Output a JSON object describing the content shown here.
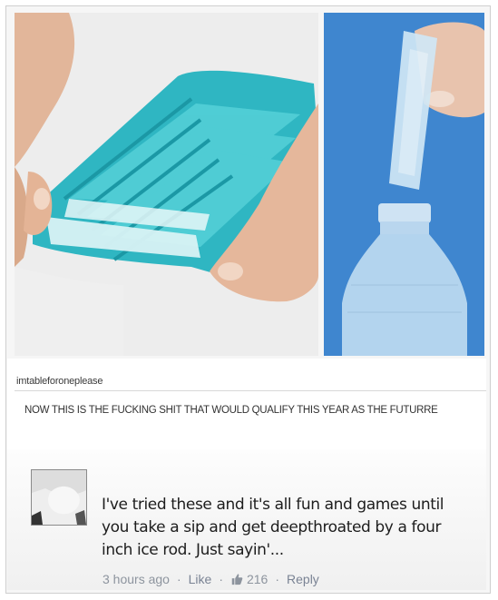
{
  "post": {
    "username": "imtableforoneplease",
    "text": "NOW THIS IS THE FUCKING SHIT THAT WOULD QUALIFY THIS YEAR AS THE FUTURRE"
  },
  "comment": {
    "text": "I've tried these and it's all fun and games until you take a sip and get deepthroated by a four inch ice rod. Just sayin'...",
    "time": "3 hours ago",
    "like_label": "Like",
    "like_count": "216",
    "reply_label": "Reply",
    "separator": "·"
  },
  "colors": {
    "tray": "#2fb6c2",
    "bottle_background": "#3f86cf"
  }
}
